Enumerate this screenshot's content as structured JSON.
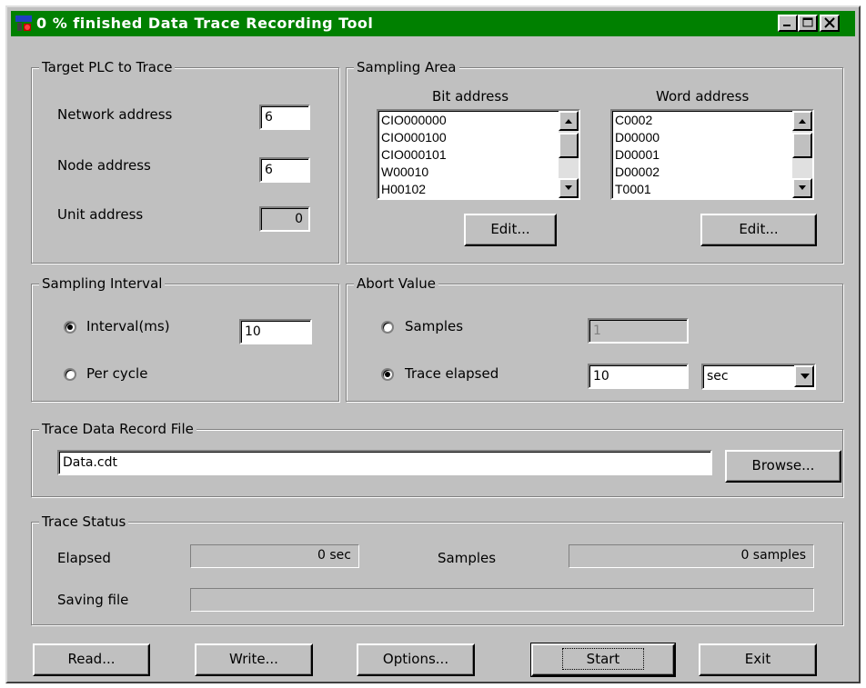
{
  "window": {
    "title": "0 % finished Data Trace Recording Tool"
  },
  "target": {
    "group_label": "Target PLC to Trace",
    "network_label": "Network address",
    "network_value": "6",
    "node_label": "Node address",
    "node_value": "6",
    "unit_label": "Unit address",
    "unit_value": "0"
  },
  "sampling_area": {
    "group_label": "Sampling Area",
    "bit_header": "Bit address",
    "word_header": "Word address",
    "bit_items": [
      "CIO000000",
      "CIO000100",
      "CIO000101",
      "W00010",
      "H00102"
    ],
    "word_items": [
      "C0002",
      "D00000",
      "D00001",
      "D00002",
      "T0001"
    ],
    "edit_bit_label": "Edit...",
    "edit_word_label": "Edit..."
  },
  "interval": {
    "group_label": "Sampling Interval",
    "interval_label": "Interval(ms)",
    "interval_value": "10",
    "per_cycle_label": "Per cycle"
  },
  "abort": {
    "group_label": "Abort Value",
    "samples_label": "Samples",
    "samples_value": "1",
    "elapsed_label": "Trace elapsed",
    "elapsed_value": "10",
    "unit_selected": "sec"
  },
  "record_file": {
    "group_label": "Trace Data Record File",
    "path": "Data.cdt",
    "browse_label": "Browse..."
  },
  "status": {
    "group_label": "Trace Status",
    "elapsed_label": "Elapsed",
    "elapsed_value": "0 sec",
    "samples_label": "Samples",
    "samples_value": "0 samples",
    "saving_label": "Saving file",
    "saving_value": ""
  },
  "buttons": {
    "read": "Read...",
    "write": "Write...",
    "options": "Options...",
    "start": "Start",
    "exit": "Exit"
  },
  "colors": {
    "titlebar": "#008000",
    "face": "#c0c0c0"
  }
}
